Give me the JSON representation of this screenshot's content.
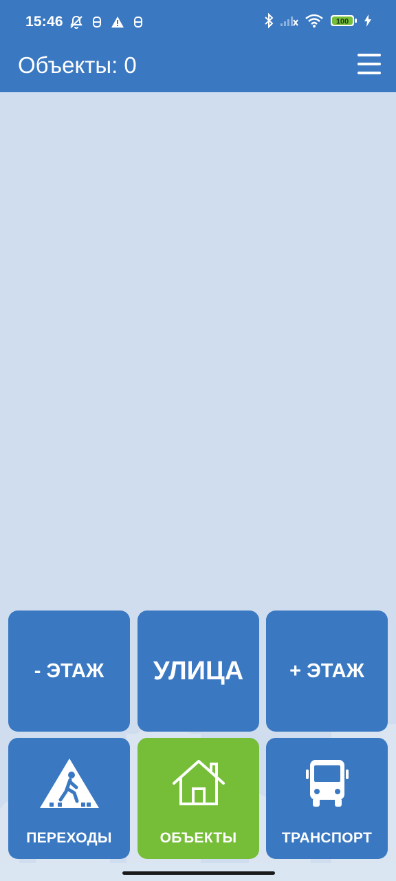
{
  "status_bar": {
    "time": "15:46",
    "battery": "100",
    "icons_left": [
      "bell-off-icon",
      "robot-icon",
      "warning-icon",
      "robot-icon"
    ],
    "icons_right": [
      "bluetooth-icon",
      "signal-icon",
      "wifi-icon",
      "battery-icon",
      "charging-icon"
    ]
  },
  "app_bar": {
    "title": "Объекты: 0",
    "menu_icon": "hamburger-menu-icon"
  },
  "buttons": {
    "floor_down": "- ЭТАЖ",
    "street": "УЛИЦА",
    "floor_up": "+ ЭТАЖ",
    "crossings": "ПЕРЕХОДЫ",
    "objects": "ОБЪЕКТЫ",
    "transport": "ТРАНСПОРТ"
  },
  "colors": {
    "primary": "#3a78c1",
    "active": "#76bd38",
    "background": "#cfddef"
  }
}
